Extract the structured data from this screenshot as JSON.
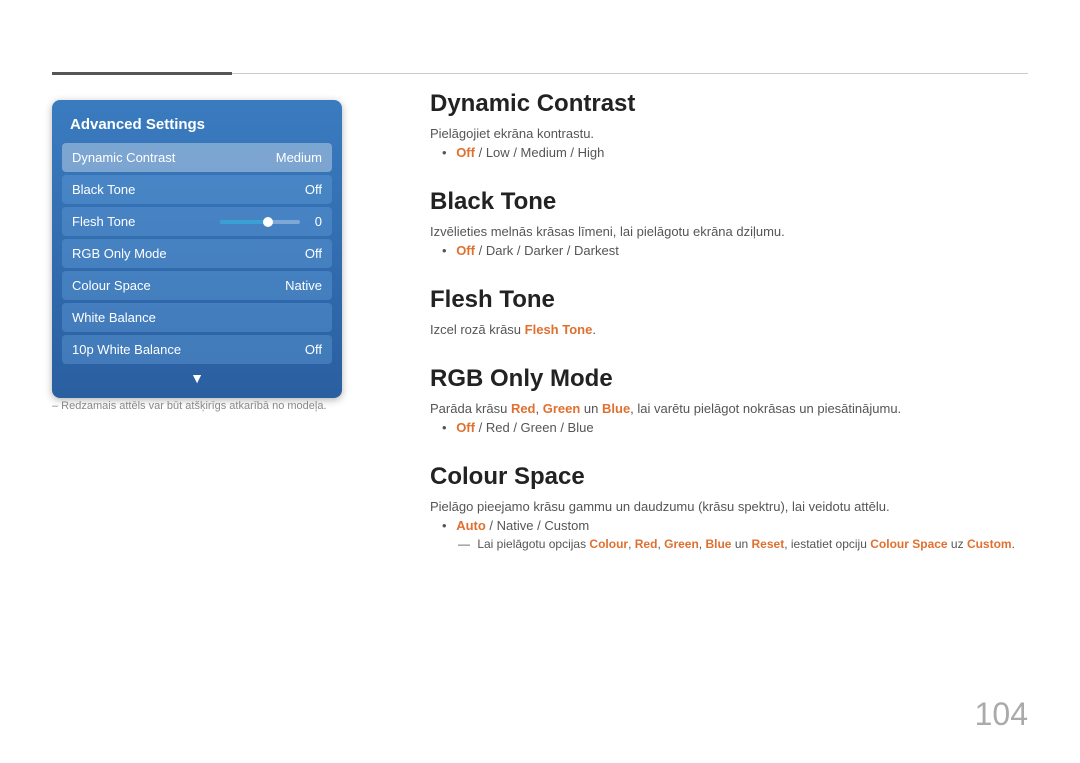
{
  "top": {
    "lines": true
  },
  "sidebar": {
    "title": "Advanced Settings",
    "items": [
      {
        "label": "Dynamic Contrast",
        "value": "Medium",
        "active": true
      },
      {
        "label": "Black Tone",
        "value": "Off",
        "active": false
      },
      {
        "label": "Flesh Tone",
        "value": "0",
        "active": false,
        "slider": true
      },
      {
        "label": "RGB Only Mode",
        "value": "Off",
        "active": false
      },
      {
        "label": "Colour Space",
        "value": "Native",
        "active": false
      },
      {
        "label": "White Balance",
        "value": "",
        "active": false
      },
      {
        "label": "10p White Balance",
        "value": "Off",
        "active": false
      }
    ]
  },
  "note": "– Redzamais attēls var būt atšķirīgs atkarībā no modeļa.",
  "sections": [
    {
      "id": "dynamic-contrast",
      "title": "Dynamic Contrast",
      "desc": "Pielāgojiet ekrāna kontrastu.",
      "options_prefix": "",
      "options": [
        {
          "text": "Off",
          "orange": true
        },
        {
          "text": " / ",
          "orange": false
        },
        {
          "text": "Low",
          "orange": false
        },
        {
          "text": " / ",
          "orange": false
        },
        {
          "text": "Medium",
          "orange": false
        },
        {
          "text": " / ",
          "orange": false
        },
        {
          "text": "High",
          "orange": false
        }
      ],
      "subnote": ""
    },
    {
      "id": "black-tone",
      "title": "Black Tone",
      "desc": "Izvēlieties melnās krāsas līmeni, lai pielāgotu ekrāna dziļumu.",
      "options": [
        {
          "text": "Off",
          "orange": true
        },
        {
          "text": " / ",
          "orange": false
        },
        {
          "text": "Dark",
          "orange": false
        },
        {
          "text": " / ",
          "orange": false
        },
        {
          "text": "Darker",
          "orange": false
        },
        {
          "text": " / ",
          "orange": false
        },
        {
          "text": "Darkest",
          "orange": false
        }
      ],
      "subnote": ""
    },
    {
      "id": "flesh-tone",
      "title": "Flesh Tone",
      "desc": "Izcel rozā krāsu ",
      "desc_orange": "Flesh Tone",
      "desc_end": ".",
      "options": [],
      "subnote": ""
    },
    {
      "id": "rgb-only-mode",
      "title": "RGB Only Mode",
      "desc": "Parāda krāsu ",
      "desc_parts": [
        {
          "text": "Red",
          "orange": true
        },
        {
          "text": ", ",
          "orange": false
        },
        {
          "text": "Green",
          "orange": true
        },
        {
          "text": " un ",
          "orange": false
        },
        {
          "text": "Blue",
          "orange": true
        },
        {
          "text": ", lai varētu pielāgot nokrāsas un piesātinājumu.",
          "orange": false
        }
      ],
      "options": [
        {
          "text": "Off",
          "orange": true
        },
        {
          "text": " / ",
          "orange": false
        },
        {
          "text": "Red",
          "orange": false
        },
        {
          "text": " / ",
          "orange": false
        },
        {
          "text": "Green",
          "orange": false
        },
        {
          "text": " / ",
          "orange": false
        },
        {
          "text": "Blue",
          "orange": false
        }
      ],
      "subnote": ""
    },
    {
      "id": "colour-space",
      "title": "Colour Space",
      "desc": "Pielāgo pieejamo krāsu gammu un daudzumu (krāsu spektru), lai veidotu attēlu.",
      "options": [
        {
          "text": "Auto",
          "orange": true
        },
        {
          "text": " / ",
          "orange": false
        },
        {
          "text": "Native",
          "orange": false
        },
        {
          "text": " / ",
          "orange": false
        },
        {
          "text": "Custom",
          "orange": false
        }
      ],
      "subnote": "Lai pielāgotu opcijas Colour, Red, Green, Blue un Reset, iestatiet opciju Colour Space uz Custom.",
      "subnote_parts": [
        {
          "text": "Lai pielāgotu opcijas ",
          "orange": false
        },
        {
          "text": "Colour",
          "orange": true
        },
        {
          "text": ", ",
          "orange": false
        },
        {
          "text": "Red",
          "orange": true
        },
        {
          "text": ", ",
          "orange": false
        },
        {
          "text": "Green",
          "orange": true
        },
        {
          "text": ", ",
          "orange": false
        },
        {
          "text": "Blue",
          "orange": true
        },
        {
          "text": " un ",
          "orange": false
        },
        {
          "text": "Reset",
          "orange": true
        },
        {
          "text": ", iestatiet opciju ",
          "orange": false
        },
        {
          "text": "Colour Space",
          "orange": true
        },
        {
          "text": " uz ",
          "orange": false
        },
        {
          "text": "Custom",
          "orange": true
        },
        {
          "text": ".",
          "orange": false
        }
      ]
    }
  ],
  "page_number": "104"
}
